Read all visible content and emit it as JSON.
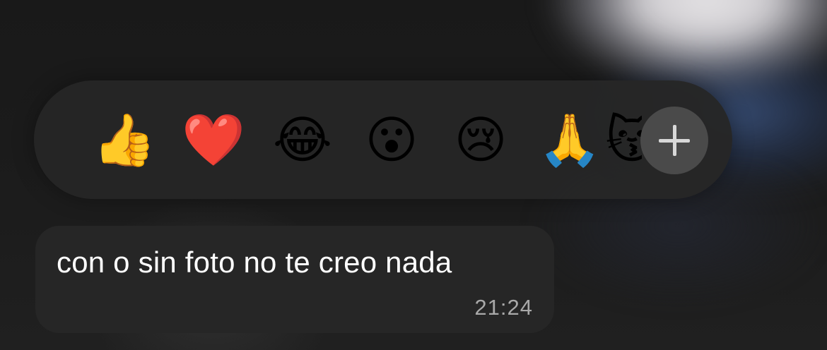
{
  "reaction_bar": {
    "emojis": [
      {
        "name": "thumbs-up-icon",
        "char": "👍"
      },
      {
        "name": "heart-icon",
        "char": "❤️"
      },
      {
        "name": "tears-of-joy-icon",
        "char": "😂"
      },
      {
        "name": "surprised-face-icon",
        "char": "😮"
      },
      {
        "name": "crying-face-icon",
        "char": "😢"
      },
      {
        "name": "folded-hands-icon",
        "char": "🙏"
      },
      {
        "name": "kissing-cat-icon",
        "char": "😽"
      }
    ],
    "more_button_icon": "plus-icon"
  },
  "message": {
    "text": "con o sin foto no te creo nada",
    "time": "21:24"
  },
  "colors": {
    "background": "#1a1a1a",
    "bar": "#262626",
    "bubble": "#262626",
    "plus_button": "#4a4a4a",
    "timestamp": "#a9a9a9"
  }
}
